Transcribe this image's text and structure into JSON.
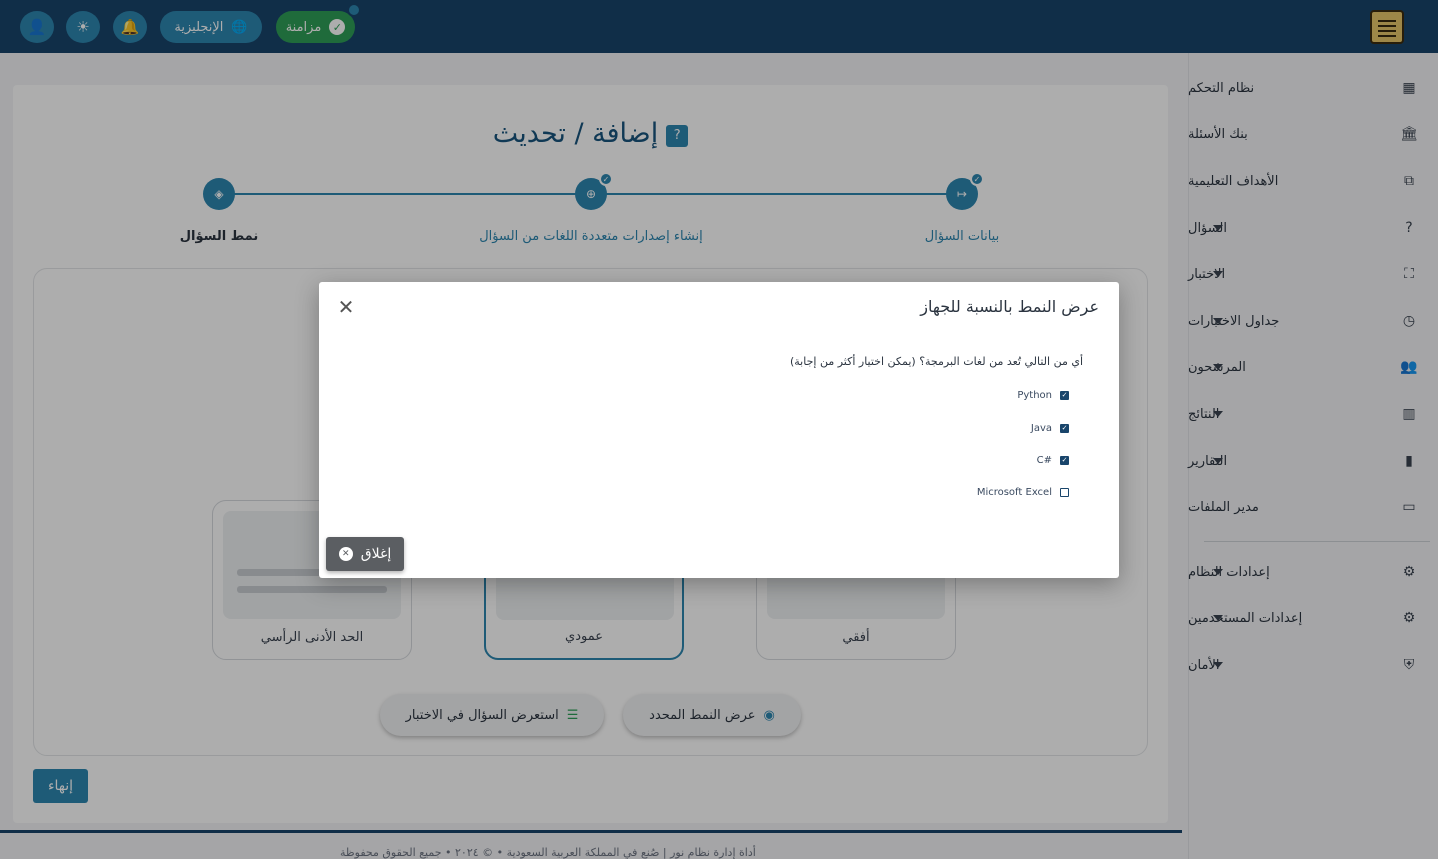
{
  "topbar": {
    "language_label": "الإنجليزية",
    "sync_label": "مزامنة"
  },
  "sidebar": {
    "items": [
      {
        "label": "نظام التحكم",
        "icon": "dashboard-icon",
        "glyph": "▦"
      },
      {
        "label": "بنك الأسئلة",
        "icon": "bank-icon",
        "glyph": "🏛"
      },
      {
        "label": "الأهداف التعليمية",
        "icon": "objectives-icon",
        "glyph": "⧉"
      },
      {
        "label": "السؤال",
        "icon": "question-icon",
        "glyph": "?"
      },
      {
        "label": "الاختبار",
        "icon": "exam-icon",
        "glyph": "⛶"
      },
      {
        "label": "جداول الاختبارات",
        "icon": "clock-icon",
        "glyph": "◷"
      },
      {
        "label": "المرشحون",
        "icon": "people-icon",
        "glyph": "👥"
      },
      {
        "label": "النتائج",
        "icon": "results-icon",
        "glyph": "▥"
      },
      {
        "label": "التقارير",
        "icon": "bar-chart-icon",
        "glyph": "▮"
      },
      {
        "label": "مدير الملفات",
        "icon": "folder-icon",
        "glyph": "▭"
      },
      {
        "label": "إعدادات النظام",
        "icon": "settings-icon",
        "glyph": "⚙"
      },
      {
        "label": "إعدادات المستخدمين",
        "icon": "user-settings-icon",
        "glyph": "⚙"
      },
      {
        "label": "الأمان",
        "icon": "shield-icon",
        "glyph": "⛨"
      }
    ]
  },
  "page": {
    "title": "إضافة / تحديث",
    "steps": [
      {
        "label": "بيانات السؤال",
        "glyph": "↦"
      },
      {
        "label": "إنشاء إصدارات متعددة اللغات من السؤال",
        "glyph": "⊕"
      },
      {
        "label": "نمط السؤال",
        "glyph": "◈"
      }
    ],
    "layouts": [
      {
        "label": "أفقي"
      },
      {
        "label": "عمودي"
      },
      {
        "label": "الحد الأدنى الرأسي"
      }
    ],
    "actions": {
      "view_selected": "عرض النمط المحدد",
      "preview_in_exam": "استعرض السؤال في الاختبار"
    },
    "finish_label": "إنهاء",
    "footer": "أداة إدارة نظام نور   |   صُنع في المملكة العربية السعودية   •   © ٢٠٢٤   •   جميع الحقوق محفوظة"
  },
  "modal": {
    "title": "عرض النمط بالنسبة للجهاز",
    "question": "أي من التالي تُعد من لغات البرمجة؟ (يمكن اختيار أكثر من إجابة)",
    "options": [
      {
        "label": "Python",
        "checked": true
      },
      {
        "label": "Java",
        "checked": true
      },
      {
        "label": "C#",
        "checked": true
      },
      {
        "label": "Microsoft Excel",
        "checked": false
      }
    ],
    "close_label": "إغلاق"
  }
}
